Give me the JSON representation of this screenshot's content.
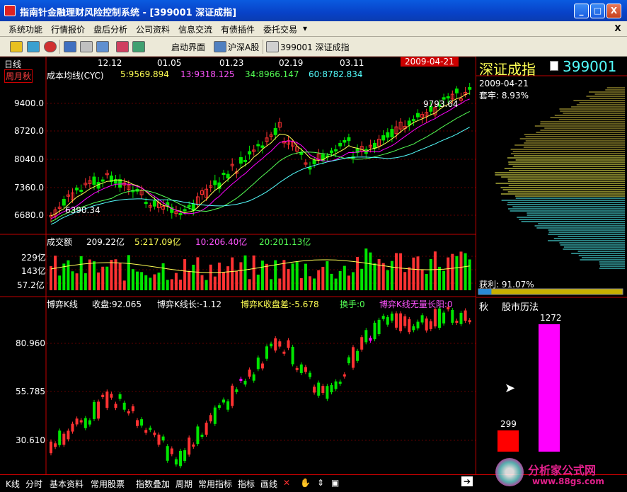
{
  "window": {
    "title": "指南针金融理财风险控制系统 - [399001 深证成指]",
    "buttons": [
      "_",
      "□",
      "X"
    ]
  },
  "menu": {
    "items": [
      "系统功能",
      "行情报价",
      "盘后分析",
      "公司资料",
      "信息交流",
      "有债插件",
      "委托交易",
      "▾"
    ],
    "close": "X"
  },
  "toolbar": {
    "startup": "启动界面",
    "market": "沪深A股",
    "current": "399001 深证成指"
  },
  "main_chart": {
    "period_label": "日线",
    "dates": [
      "12.12",
      "01.05",
      "01.23",
      "02.19",
      "03.11"
    ],
    "highlight_date": "2009-04-21",
    "period_tabs": "周月秋",
    "indicator": "成本均线(CYC)",
    "ma5": "5:9569.894",
    "ma13": "13:9318.125",
    "ma34": "34:8966.147",
    "ma60": "60:8782.834",
    "yticks": [
      "9400.0",
      "8720.0",
      "8040.0",
      "7360.0",
      "6680.0"
    ],
    "low_note": "6390.34",
    "high_note": "9793.64"
  },
  "volume": {
    "title": "成交额",
    "value": "209.22亿",
    "ma5": "5:217.09亿",
    "ma10": "10:206.40亿",
    "ma20": "20:201.13亿",
    "yticks": [
      "229亿",
      "143亿",
      "57.2亿"
    ]
  },
  "game": {
    "title": "博弈K线",
    "close": "收盘:92.065",
    "len": "博弈K线长:-1.12",
    "diff": "博弈K收盘差:-5.678",
    "turnover": "换手:0",
    "novol": "博弈K线无量长阳:0",
    "yticks": [
      "80.960",
      "55.785",
      "30.610"
    ]
  },
  "right_panel": {
    "name": "深证成指",
    "code": "399001",
    "date": "2009-04-21",
    "trapped": "套牢: 8.93%",
    "profit": "获利: 91.07%",
    "profit_fraction": 0.91,
    "history_title_a": "秋",
    "history_title_b": "股市历法",
    "bar_small_value": "299",
    "bar_large_value": "1272"
  },
  "bottom": {
    "items": [
      "K线",
      "分时",
      "基本资料",
      "常用股票",
      "指数叠加",
      "周期",
      "常用指标",
      "指标",
      "画线"
    ],
    "watermark": "分析家公式网",
    "watermark_url": "www.88gs.com"
  },
  "colors": {
    "up": "#ff3232",
    "down": "#00e600",
    "magenta": "#ff00ff",
    "cyan": "#54ffff",
    "yellow": "#ffff54",
    "frame": "#c00000"
  }
}
